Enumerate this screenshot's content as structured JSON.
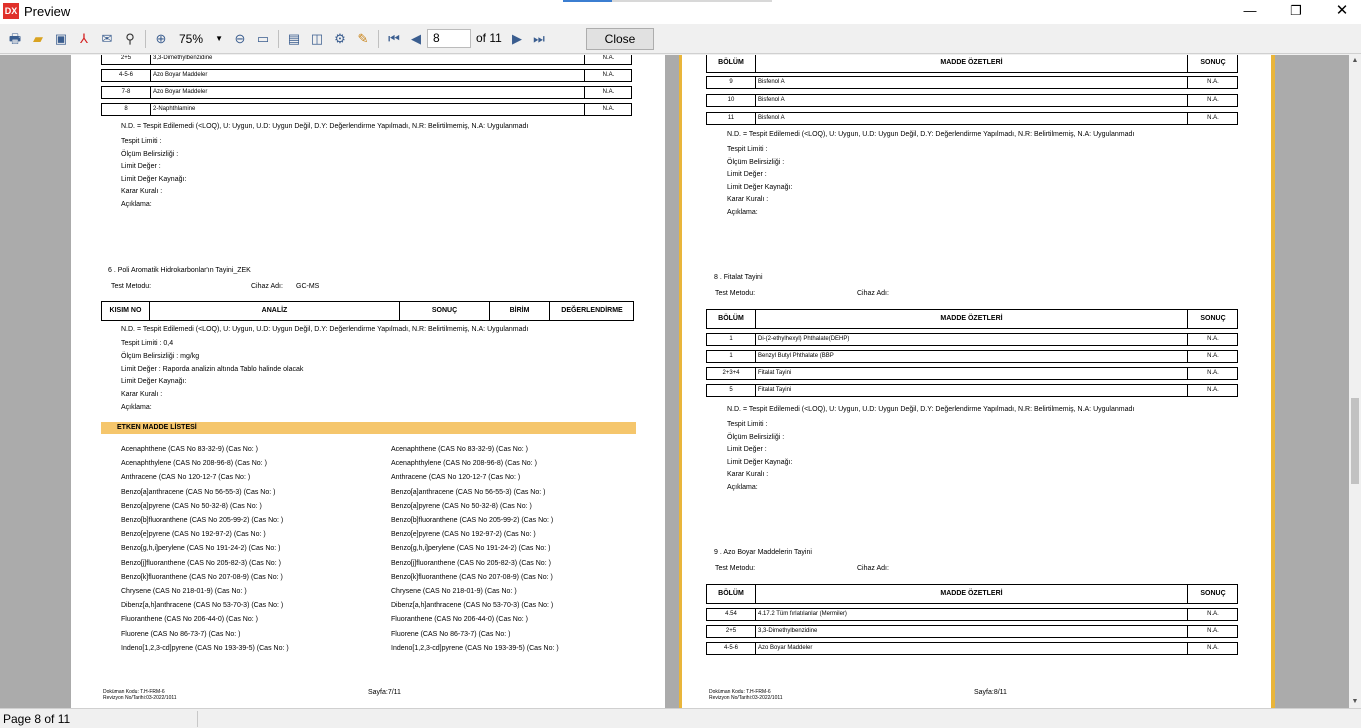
{
  "window": {
    "logo": "DX",
    "title": "Preview",
    "min_glyph": "—",
    "max_glyph": "❐",
    "close_glyph": "✕"
  },
  "toolbar": {
    "icons": [
      "print-icon",
      "open-folder-icon",
      "save-icon",
      "pdf-icon",
      "email-icon",
      "find-icon",
      "zoom-in-icon",
      "zoom-out-icon",
      "fit-page-icon",
      "single-page-icon",
      "two-page-icon",
      "page-setup-icon",
      "edit-page-icon",
      "first-page-icon",
      "prev-page-icon",
      "next-page-icon",
      "last-page-icon"
    ],
    "zoom": "75%",
    "page_value": "8",
    "of_label": "of 11",
    "close_label": "Close"
  },
  "status": {
    "page_text": "Page 8 of 11"
  },
  "left": {
    "top_rows": [
      {
        "code": "2+5",
        "name": "3,3-Dimethylbenzidine",
        "res": "N.A."
      },
      {
        "code": "4-5-6",
        "name": "Azo Boyar Maddeler",
        "res": "N.A."
      },
      {
        "code": "7-8",
        "name": "Azo Boyar Maddeler",
        "res": "N.A."
      },
      {
        "code": "8",
        "name": "2-Naphthlamine",
        "res": "N.A."
      }
    ],
    "legend": "N.D. = Tespit Edilemedi (<LOQ), U: Uygun, U.D: Uygun Değil, D.Y: Değerlendirme Yapılmadı, N.R: Belirtilmemiş, N.A: Uygulanmadı",
    "meta1": [
      "Tespit Limiti :",
      "Ölçüm Belirsizliği :",
      "Limit Değer :",
      "Limit Değer Kaynağı:",
      "Karar Kuralı :",
      "Açıklama:"
    ],
    "section6_title": "6 .    Poli Aromatik Hidrokarbonlar'ın Tayini_ZEK",
    "test_method": "Test Metodu:",
    "device_label": "Cihaz Adı:",
    "device_value": "GC-MS",
    "table_headers": [
      "KISIM NO",
      "ANALİZ",
      "SONUÇ",
      "BİRİM",
      "DEĞERLENDİRME"
    ],
    "legend2": "N.D. = Tespit Edilemedi (<LOQ), U: Uygun, U.D: Uygun Değil, D.Y: Değerlendirme Yapılmadı, N.R: Belirtilmemiş, N.A: Uygulanmadı",
    "meta2": [
      "Tespit Limiti : 0,4",
      "Ölçüm Belirsizliği : mg/kg",
      "Limit Değer : Raporda analizin altında Tablo halinde olacak",
      "Limit Değer Kaynağı:",
      "Karar Kuralı :",
      "Açıklama:"
    ],
    "banner": "ETKEN MADDE LİSTESİ",
    "substances": [
      "Acenaphthene (CAS No 83-32-9) (Cas No:  )",
      "Acenaphthylene (CAS No 208-96-8) (Cas No:  )",
      "Anthracene (CAS No 120-12-7 (Cas No:  )",
      "Benzo[a]anthracene (CAS No 56-55-3) (Cas No:  )",
      "Benzo[a]pyrene (CAS No 50-32-8) (Cas No:  )",
      "Benzo[b]fluoranthene (CAS No 205-99-2) (Cas No:  )",
      "Benzo[e]pyrene (CAS No 192-97-2) (Cas No:  )",
      "Benzo[g,h,i]perylene (CAS No 191-24-2) (Cas No:  )",
      "Benzo[j]fluoranthene (CAS No 205-82-3) (Cas No:  )",
      "Benzo[k]fluoranthene (CAS No 207-08-9) (Cas No:  )",
      "Chrysene (CAS No 218-01-9) (Cas No:  )",
      "Dibenz[a,h]anthracene (CAS No 53-70-3) (Cas No:  )",
      "Fluoranthene (CAS No 206-44-0) (Cas No:  )",
      "Fluorene (CAS No 86-73-7) (Cas No:  )",
      "Indeno[1,2,3-cd]pyrene (CAS No 193-39-5) (Cas No:  )"
    ],
    "footer_code": "Doküman Kodu: T.H-FRM-6",
    "footer_rev": "Revizyon No/Tarihi:03-2022/1011",
    "footer_page": "Sayfa:7/11"
  },
  "right": {
    "table_headers": [
      "BÖLÜM",
      "MADDE ÖZETLERİ",
      "SONUÇ"
    ],
    "rows1": [
      {
        "code": "9",
        "name": "Bisfenol A",
        "res": "N.A."
      },
      {
        "code": "10",
        "name": "Bisfenol A",
        "res": "N.A."
      },
      {
        "code": "11",
        "name": "Bisfenol A",
        "res": "N.A."
      }
    ],
    "legend": "N.D. = Tespit Edilemedi (<LOQ), U: Uygun, U.D: Uygun Değil, D.Y: Değerlendirme Yapılmadı, N.R: Belirtilmemiş, N.A: Uygulanmadı",
    "meta": [
      "Tespit Limiti :",
      "Ölçüm Belirsizliği :",
      "Limit Değer :",
      "Limit Değer Kaynağı:",
      "Karar Kuralı :",
      "Açıklama:"
    ],
    "section8_title": "8 .    Fitalat Tayini",
    "section9_title": "9 .    Azo Boyar Maddelerin Tayini",
    "test_method": "Test Metodu:",
    "device_label": "Cihaz Adı:",
    "rows2": [
      {
        "code": "1",
        "name": "Di-(2-ethylhexyl) Phthalate(DEHP)",
        "res": "N.A."
      },
      {
        "code": "1",
        "name": "Benzyl Butyl Phthalate (BBP",
        "res": "N.A."
      },
      {
        "code": "2+3+4",
        "name": "Fitalat Tayini",
        "res": "N.A."
      },
      {
        "code": "5",
        "name": "Fitalat Tayini",
        "res": "N.A."
      }
    ],
    "rows3": [
      {
        "code": "4.54",
        "name": "4.17.2 Tüm fırlatılanlar (Mermiler)",
        "res": "N.A."
      },
      {
        "code": "2+5",
        "name": "3,3-Dimethylbenzidine",
        "res": "N.A."
      },
      {
        "code": "4-5-6",
        "name": "Azo Boyar Maddeler",
        "res": "N.A."
      }
    ],
    "footer_code": "Doküman Kodu: T.H-FRM-6",
    "footer_rev": "Revizyon No/Tarihi:03-2022/1011",
    "footer_page": "Sayfa:8/11"
  }
}
